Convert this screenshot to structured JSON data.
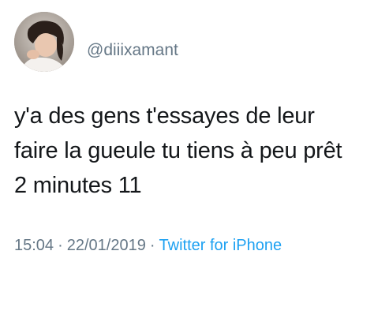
{
  "tweet": {
    "avatar": "profile-avatar",
    "handle": "@diiixamant",
    "text_lines": [
      "y'a des gens t'essayes de leur",
      "faire la gueule tu tiens à peu prêt",
      "2 minutes 11"
    ],
    "time": "15:04",
    "separator": "·",
    "date": "22/01/2019",
    "source": "Twitter for iPhone"
  },
  "colors": {
    "text": "#14171a",
    "secondary": "#657786",
    "link": "#1da1f2",
    "background": "#ffffff"
  }
}
